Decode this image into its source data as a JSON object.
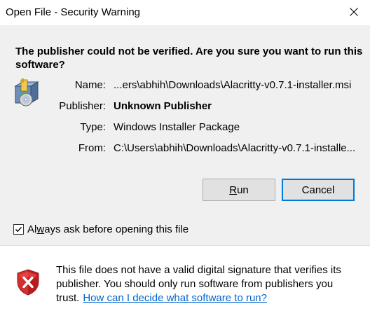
{
  "window": {
    "title": "Open File - Security Warning"
  },
  "heading": "The publisher could not be verified.  Are you sure you want to run this software?",
  "details": {
    "name_label": "Name:",
    "name_value": "...ers\\abhih\\Downloads\\Alacritty-v0.7.1-installer.msi",
    "publisher_label": "Publisher:",
    "publisher_value": "Unknown Publisher",
    "type_label": "Type:",
    "type_value": "Windows Installer Package",
    "from_label": "From:",
    "from_value": "C:\\Users\\abhih\\Downloads\\Alacritty-v0.7.1-installe..."
  },
  "buttons": {
    "run_underlined": "R",
    "run_rest": "un",
    "cancel": "Cancel"
  },
  "checkbox": {
    "label_pre": "Al",
    "label_underlined": "w",
    "label_post": "ays ask before opening this file",
    "checked": true
  },
  "footer": {
    "message": "This file does not have a valid digital signature that verifies its publisher.  You should only run software from publishers you trust.",
    "help_link": "How can I decide what software to run?"
  },
  "icons": {
    "close": "close-icon",
    "file": "installer-package-icon",
    "shield": "security-shield-error-icon",
    "checkmark": "checkmark-icon"
  },
  "colors": {
    "panel": "#f0f0f0",
    "accent": "#0078d7",
    "link": "#0066cc",
    "shield_red": "#d32f2f"
  }
}
